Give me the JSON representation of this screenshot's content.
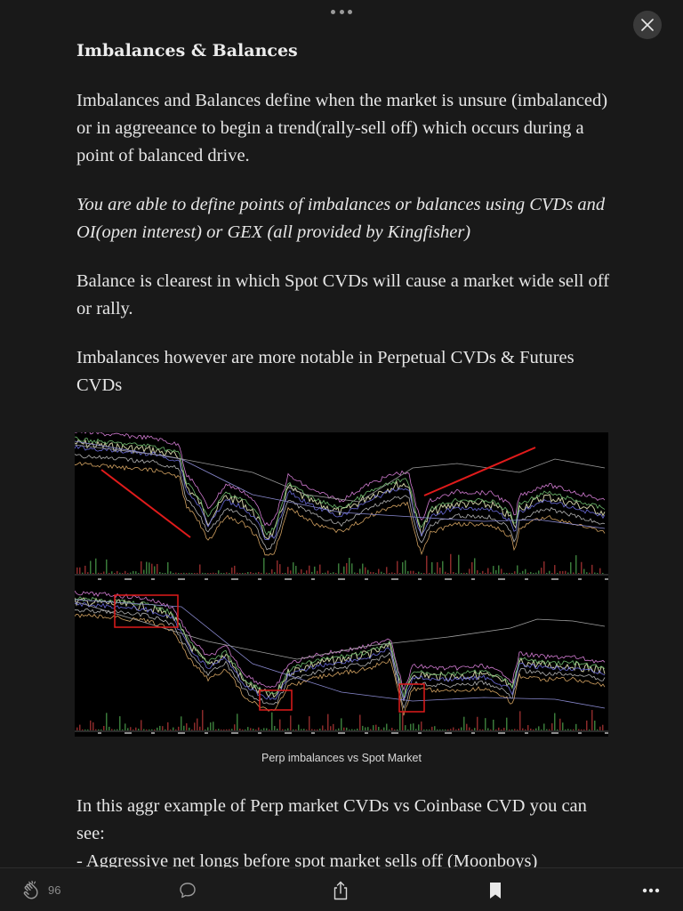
{
  "article": {
    "heading": "Imbalances & Balances",
    "paragraphs": [
      "Imbalances and Balances define when the market is unsure (imbalanced) or in aggreeance to begin a trend(rally-sell off) which occurs during a point of balanced drive.",
      "You are able to define points of imbalances or balances using CVDs and OI(open interest) or GEX (all provided by Kingfisher)",
      "Balance is clearest in which Spot CVDs will cause a market wide sell off or rally.",
      "Imbalances however are more notable in Perpetual CVDs & Futures CVDs"
    ],
    "figure_caption": "Perp imbalances vs Spot Market",
    "after_figure": [
      "In this aggr example of Perp market CVDs vs Coinbase CVD you can see:",
      "- Aggressive net longs before spot market sells off (Moonboys)"
    ]
  },
  "toolbar": {
    "clap_count": "96",
    "icons": [
      "clap-icon",
      "comment-icon",
      "share-icon",
      "bookmark-icon",
      "more-icon"
    ]
  },
  "colors": {
    "background": "#191919",
    "text": "#e6e6e6",
    "annotation_red": "#e01b1b"
  }
}
